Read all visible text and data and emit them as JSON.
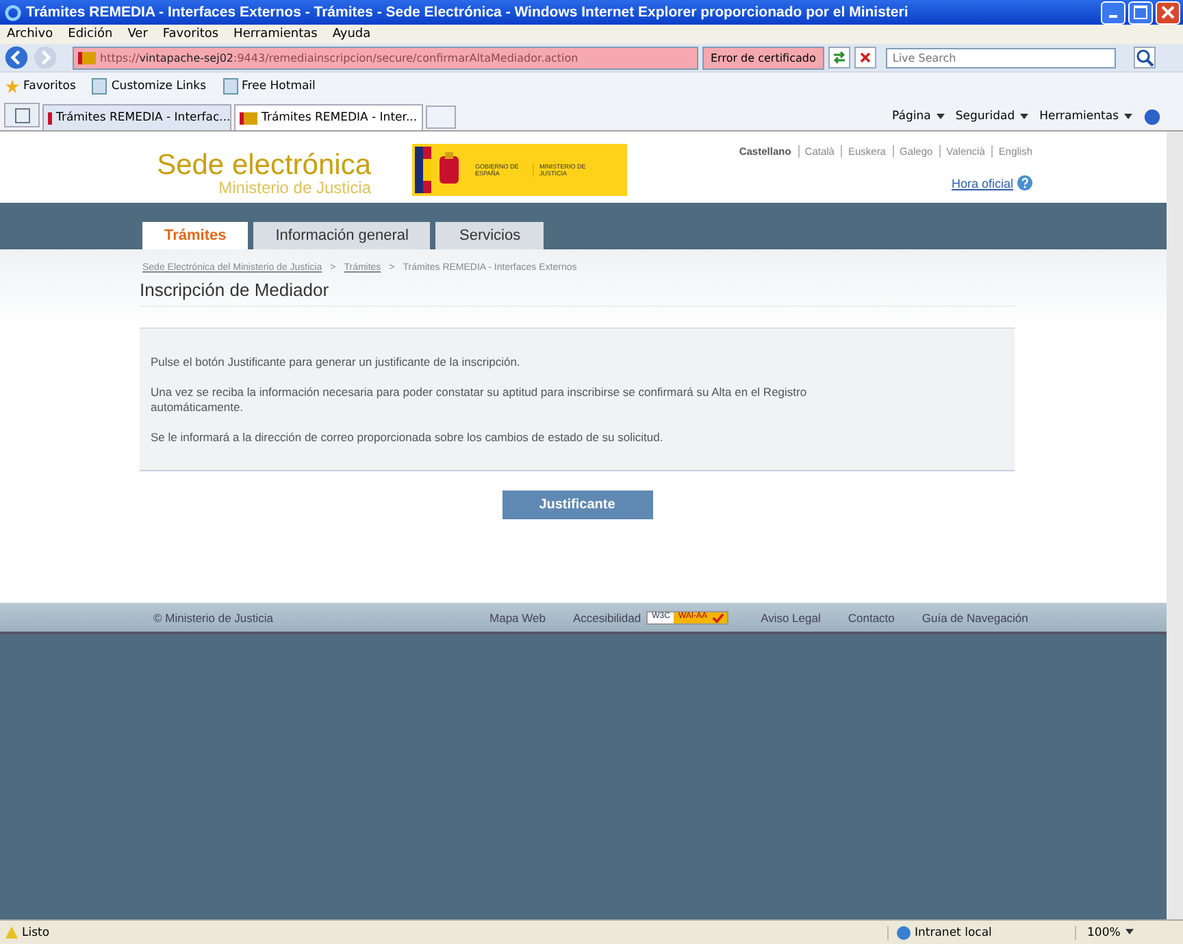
{
  "window": {
    "title": "Trámites REMEDIA - Interfaces Externos - Trámites - Sede Electrónica - Windows Internet Explorer proporcionado por el Ministeri"
  },
  "menu": [
    "Archivo",
    "Edición",
    "Ver",
    "Favoritos",
    "Herramientas",
    "Ayuda"
  ],
  "address": {
    "scheme": "https://",
    "host": "vintapache-sej02",
    "path": ":9443/remediainscripcion/secure/confirmarAltaMediador.action",
    "cert_error": "Error de certificado",
    "search_placeholder": "Live Search"
  },
  "favorites_bar": [
    {
      "label": "Favoritos",
      "kind": "star"
    },
    {
      "label": "Customize Links",
      "kind": "page"
    },
    {
      "label": "Free Hotmail",
      "kind": "page"
    }
  ],
  "browser_tabs": [
    {
      "label": "Trámites REMEDIA - Interfac...",
      "selected": false
    },
    {
      "label": "Trámites REMEDIA - Inter...",
      "selected": true
    }
  ],
  "command_bar": [
    "Página",
    "Seguridad",
    "Herramientas"
  ],
  "site": {
    "title": "Sede electrónica",
    "subtitle": "Ministerio de Justicia",
    "logo_left": "GOBIERNO DE ESPAÑA",
    "logo_right": "MINISTERIO DE JUSTICIA",
    "languages": [
      {
        "label": "Castellano",
        "selected": true
      },
      {
        "label": "Català",
        "selected": false
      },
      {
        "label": "Euskera",
        "selected": false
      },
      {
        "label": "Galego",
        "selected": false
      },
      {
        "label": "Valencià",
        "selected": false
      },
      {
        "label": "English",
        "selected": false
      }
    ],
    "clock_link": "Hora oficial"
  },
  "nav_tabs": [
    {
      "label": "Trámites",
      "selected": true
    },
    {
      "label": "Información general",
      "selected": false
    },
    {
      "label": "Servicios",
      "selected": false
    }
  ],
  "breadcrumb_separator": ">",
  "breadcrumb": [
    {
      "label": "Sede Electrónica del Ministerio de Justicia",
      "link": true
    },
    {
      "label": "Trámites",
      "link": true
    },
    {
      "label": "Trámites REMEDIA - Interfaces Externos",
      "link": false
    }
  ],
  "page_title": "Inscripción de Mediador",
  "paragraphs": [
    "Pulse el botón Justificante para generar un justificante de la inscripción.",
    "Una vez se reciba la información necesaria para poder constatar su aptitud para inscribirse se confirmará su Alta en el Registro automáticamente.",
    "Se le informará a la dirección de correo proporcionada sobre los cambios de estado de su solicitud."
  ],
  "button": "Justificante",
  "footer": {
    "copyright": "© Ministerio de Justicia",
    "links": [
      "Mapa Web",
      "Accesibilidad",
      "Aviso Legal",
      "Contacto",
      "Guía de Navegación"
    ],
    "badge_left": "W3C",
    "badge_right": "WAI-AA"
  },
  "status_bar": {
    "status": "Listo",
    "zone": "Intranet local",
    "zoom": "100%"
  }
}
